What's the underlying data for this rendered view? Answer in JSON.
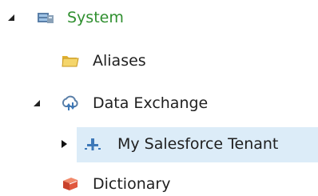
{
  "tree": {
    "system": {
      "label": "System",
      "icon": "server-icon",
      "expanded": true
    },
    "aliases": {
      "label": "Aliases",
      "icon": "folder-icon"
    },
    "data_exchange": {
      "label": "Data Exchange",
      "icon": "cloud-sync-icon",
      "expanded": true
    },
    "salesforce": {
      "label": "My Salesforce Tenant",
      "icon": "connector-icon",
      "selected": true,
      "expanded": false
    },
    "dictionary": {
      "label": "Dictionary",
      "icon": "book-icon"
    }
  },
  "colors": {
    "system_text": "#2f8f2f",
    "selected_bg": "#dcecf8",
    "text": "#1f1f1f"
  }
}
